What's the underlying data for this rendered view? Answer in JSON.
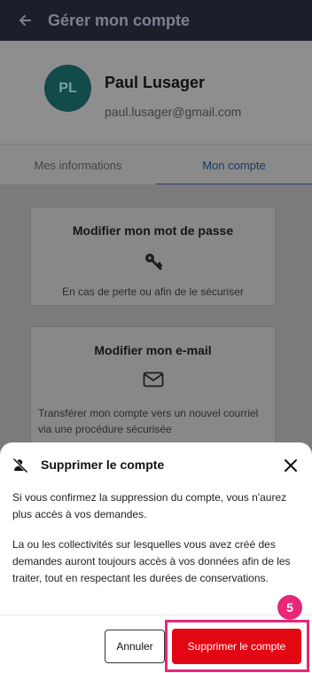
{
  "header": {
    "title": "Gérer mon compte",
    "back_icon": "arrow-left-icon"
  },
  "profile": {
    "initials": "PL",
    "name": "Paul Lusager",
    "email": "paul.lusager@gmail.com"
  },
  "tabs": [
    {
      "label": "Mes informations",
      "active": false
    },
    {
      "label": "Mon compte",
      "active": true
    }
  ],
  "cards": [
    {
      "title": "Modifier mon mot de passe",
      "icon": "key-icon",
      "description": "En cas de perte ou afin de le sécuriser"
    },
    {
      "title": "Modifier mon e-mail",
      "icon": "envelope-icon",
      "description": "Transférer mon compte vers un nouvel courriel via une procédure sécurisée"
    }
  ],
  "dialog": {
    "title": "Supprimer le compte",
    "icon": "user-remove-icon",
    "paragraph1": "Si vous confirmez la suppression du compte, vous n'aurez plus accès à vos demandes.",
    "paragraph2": "La ou les collectivités sur lesquelles vous avez créé des demandes auront toujours accès à vos données afin de les traiter, tout en respectant les durées de conservations.",
    "cancel_label": "Annuler",
    "confirm_label": "Supprimer le compte",
    "step_badge": "5"
  },
  "colors": {
    "danger": "#e30613",
    "highlight": "#e7277a",
    "avatar_bg": "#134a4a",
    "header_bg": "#1c1e2a"
  }
}
